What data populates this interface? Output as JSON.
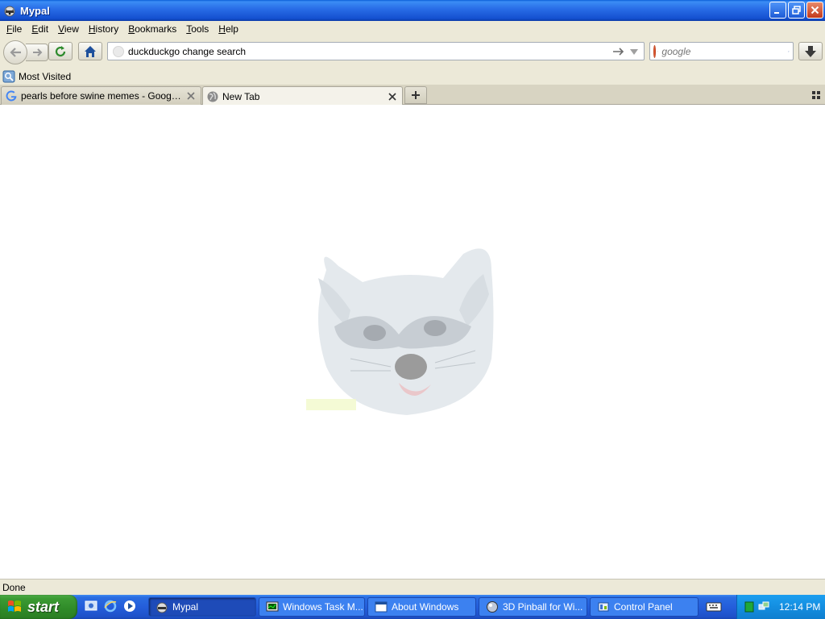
{
  "window": {
    "title": "Mypal",
    "minimize_label": "minimize",
    "restore_label": "restore",
    "close_label": "close"
  },
  "menu": {
    "items": [
      {
        "first": "F",
        "rest": "ile"
      },
      {
        "first": "E",
        "rest": "dit"
      },
      {
        "first": "V",
        "rest": "iew"
      },
      {
        "first": "H",
        "rest": "istory"
      },
      {
        "first": "B",
        "rest": "ookmarks"
      },
      {
        "first": "T",
        "rest": "ools"
      },
      {
        "first": "H",
        "rest": "elp"
      }
    ]
  },
  "nav": {
    "url": "duckduckgo change search",
    "search_placeholder": "google"
  },
  "bookmarks": {
    "items": [
      {
        "label": "Most Visited"
      }
    ]
  },
  "tabs": [
    {
      "label": "pearls before swine memes - Google Sear...",
      "active": false
    },
    {
      "label": "New Tab",
      "active": true
    }
  ],
  "status": {
    "text": "Done"
  },
  "taskbar": {
    "start_label": "start",
    "tasks": [
      {
        "label": "Mypal",
        "active": true
      },
      {
        "label": "Windows Task M...",
        "active": false
      },
      {
        "label": "About Windows",
        "active": false
      },
      {
        "label": "3D Pinball for Wi...",
        "active": false
      },
      {
        "label": "Control Panel",
        "active": false
      }
    ],
    "clock": "12:14 PM"
  },
  "colors": {
    "titlebar": "#245edb",
    "start_button": "#3c9b34",
    "tray": "#148ee0"
  }
}
